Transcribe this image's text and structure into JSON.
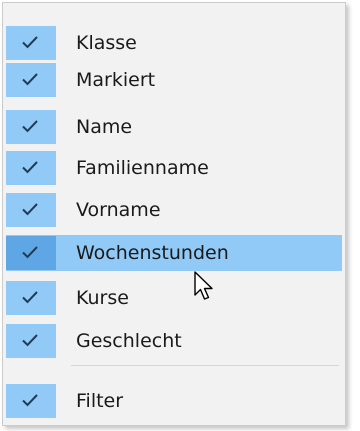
{
  "menu": {
    "items": [
      {
        "label": "Klasse",
        "checked": true
      },
      {
        "label": "Markiert",
        "checked": true
      },
      {
        "label": "Name",
        "checked": true
      },
      {
        "label": "Familienname",
        "checked": true
      },
      {
        "label": "Vorname",
        "checked": true
      },
      {
        "label": "Wochenstunden",
        "checked": true,
        "highlighted": true
      },
      {
        "label": "Kurse",
        "checked": true
      },
      {
        "label": "Geschlecht",
        "checked": true
      }
    ],
    "footer_item": {
      "label": "Filter",
      "checked": true
    }
  },
  "colors": {
    "menu_background": "#f2f2f2",
    "check_column": "#91c9f7",
    "highlight_row": "#91c9f7",
    "highlight_check": "#5ea7e4",
    "checkmark": "#1f3b56"
  },
  "icons": {
    "check": "checkmark-icon",
    "cursor": "mouse-pointer-icon"
  }
}
